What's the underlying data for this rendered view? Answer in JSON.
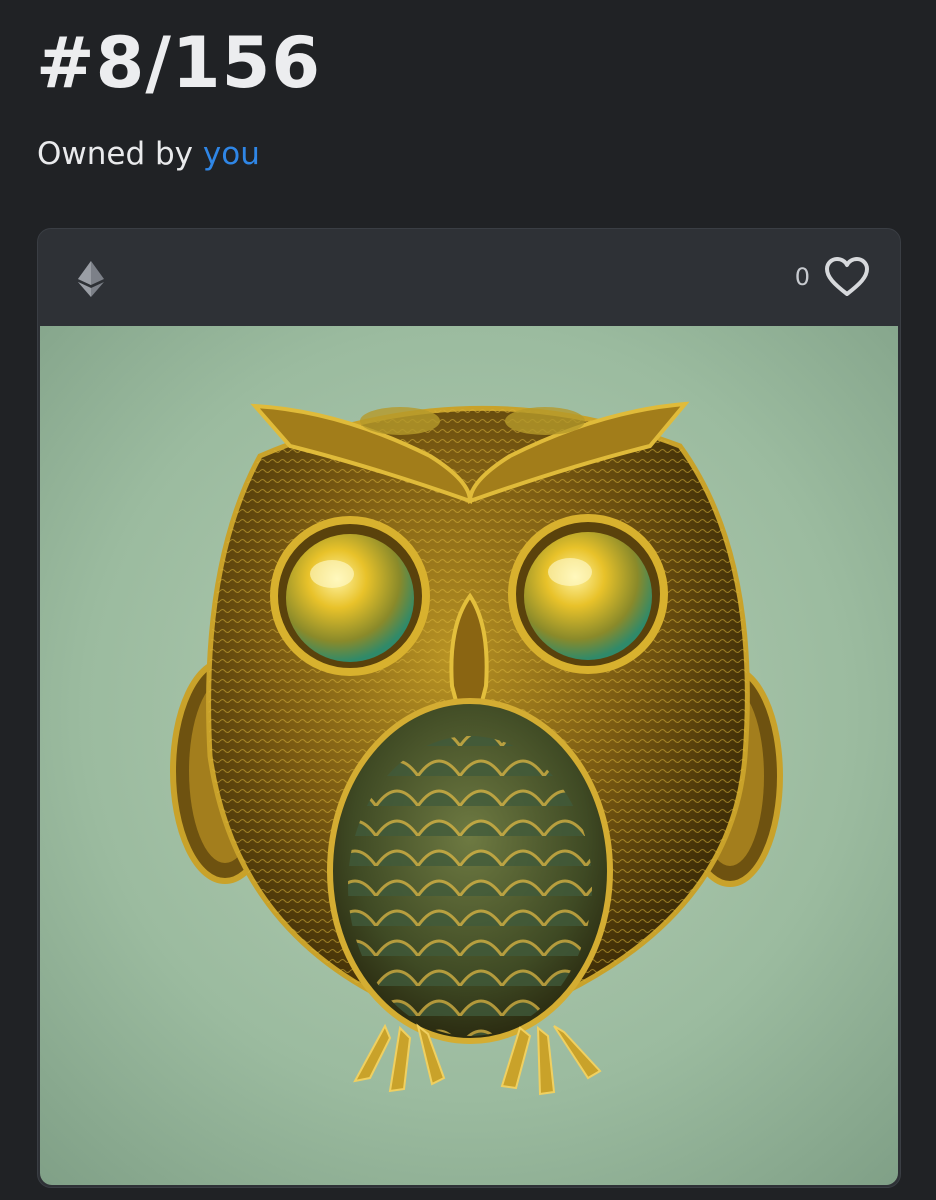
{
  "header": {
    "title": "#8/156",
    "owner_prefix": "Owned by",
    "owner_link": "you"
  },
  "card": {
    "chain_icon": "ethereum-icon",
    "like_count": "0",
    "like_icon": "heart-outline-icon",
    "artwork": {
      "subject": "golden-owl-image"
    }
  },
  "colors": {
    "background": "#202225",
    "card": "#2e3136",
    "link": "#2f86e6",
    "artwork_bg": "#98b89e",
    "gold": "#c9a22a"
  }
}
